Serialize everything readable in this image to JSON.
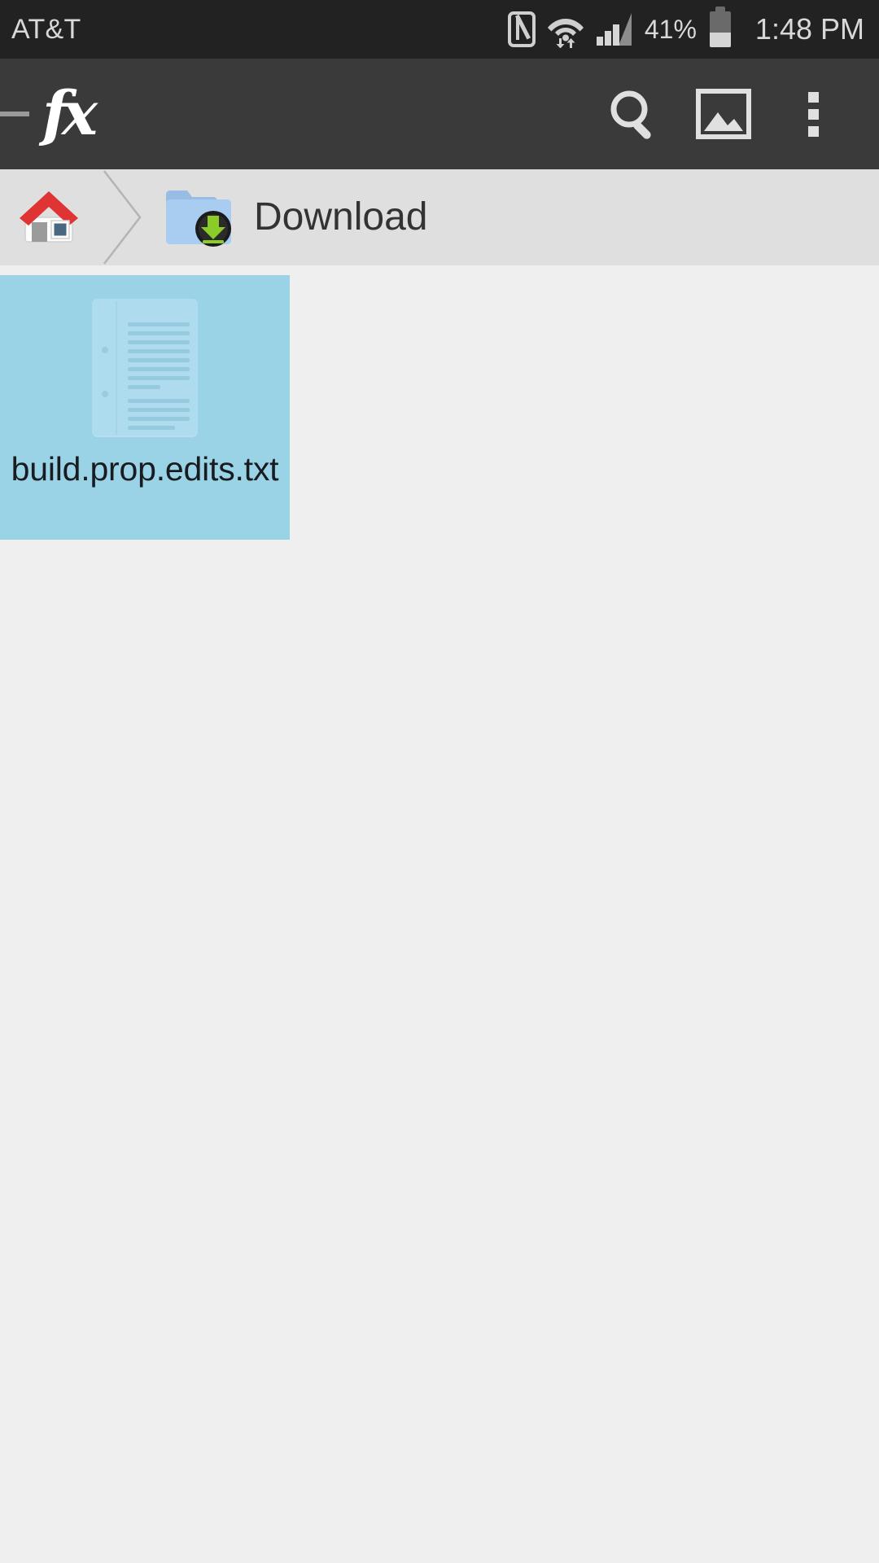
{
  "status_bar": {
    "carrier": "AT&T",
    "battery_percent_label": "41%",
    "battery_level_pct": 41,
    "clock": "1:48 PM",
    "icons": [
      "nfc-icon",
      "wifi-icon",
      "signal-icon",
      "battery-icon"
    ],
    "background_color": "#222222",
    "text_color": "#d8d8d8"
  },
  "toolbar": {
    "app_logo_text": "fx",
    "drawer_handle": "drawer-dash",
    "actions": [
      {
        "name": "search-icon",
        "label": "Search"
      },
      {
        "name": "image-icon",
        "label": "Gallery"
      },
      {
        "name": "overflow-menu-icon",
        "label": "More options"
      }
    ],
    "background_color": "#3a3a3a"
  },
  "breadcrumb": {
    "background_color": "#dfdfdf",
    "items": [
      {
        "icon": "home-icon",
        "label": ""
      },
      {
        "icon": "folder-download-icon",
        "label": "Download"
      }
    ]
  },
  "content": {
    "background_color": "#efefef",
    "selection_color": "#9ad2e6",
    "files": [
      {
        "name": "build.prop.edits.txt",
        "icon": "text-document-icon",
        "selected": true
      }
    ]
  }
}
